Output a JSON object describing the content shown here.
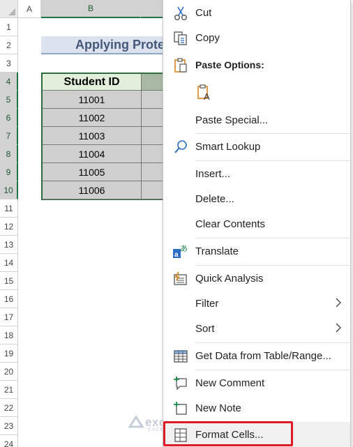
{
  "sheet": {
    "columns": [
      "A",
      "B"
    ],
    "rows": [
      "1",
      "2",
      "3",
      "4",
      "5",
      "6",
      "7",
      "8",
      "9",
      "10",
      "11",
      "12",
      "13",
      "14",
      "15",
      "16",
      "17",
      "18",
      "19",
      "20",
      "21",
      "22",
      "23",
      "24"
    ],
    "title_text": "Applying Prote",
    "table_header": "Student ID",
    "student_ids": [
      "11001",
      "11002",
      "11003",
      "11004",
      "11005",
      "11006"
    ]
  },
  "menu": {
    "cut": {
      "label": "Cut",
      "icon": "scissors-icon"
    },
    "copy": {
      "label": "Copy",
      "icon": "copy-icon"
    },
    "paste_options": {
      "label": "Paste Options:",
      "icon": "clipboard-icon"
    },
    "paste_values": {
      "icon": "paste-values-icon"
    },
    "paste_special": {
      "label": "Paste Special..."
    },
    "smart_lookup": {
      "label": "Smart Lookup",
      "icon": "search-icon"
    },
    "insert": {
      "label": "Insert..."
    },
    "delete": {
      "label": "Delete..."
    },
    "clear_contents": {
      "label": "Clear Contents"
    },
    "translate": {
      "label": "Translate",
      "icon": "translate-icon"
    },
    "quick_analysis": {
      "label": "Quick Analysis",
      "icon": "quick-analysis-icon"
    },
    "filter": {
      "label": "Filter",
      "icon": "chevron-right-icon"
    },
    "sort": {
      "label": "Sort",
      "icon": "chevron-right-icon"
    },
    "get_data": {
      "label": "Get Data from Table/Range...",
      "icon": "table-icon"
    },
    "new_comment": {
      "label": "New Comment",
      "icon": "comment-icon"
    },
    "new_note": {
      "label": "New Note",
      "icon": "note-icon"
    },
    "format_cells": {
      "label": "Format Cells...",
      "icon": "format-cells-icon"
    }
  },
  "watermark": {
    "name": "exceldemy",
    "tagline": "EXCEL · DATA · BI"
  },
  "colors": {
    "accent_green": "#217346",
    "highlight_red": "#e01a24",
    "icon_blue": "#2b6cc4",
    "icon_orange": "#d9831f"
  }
}
